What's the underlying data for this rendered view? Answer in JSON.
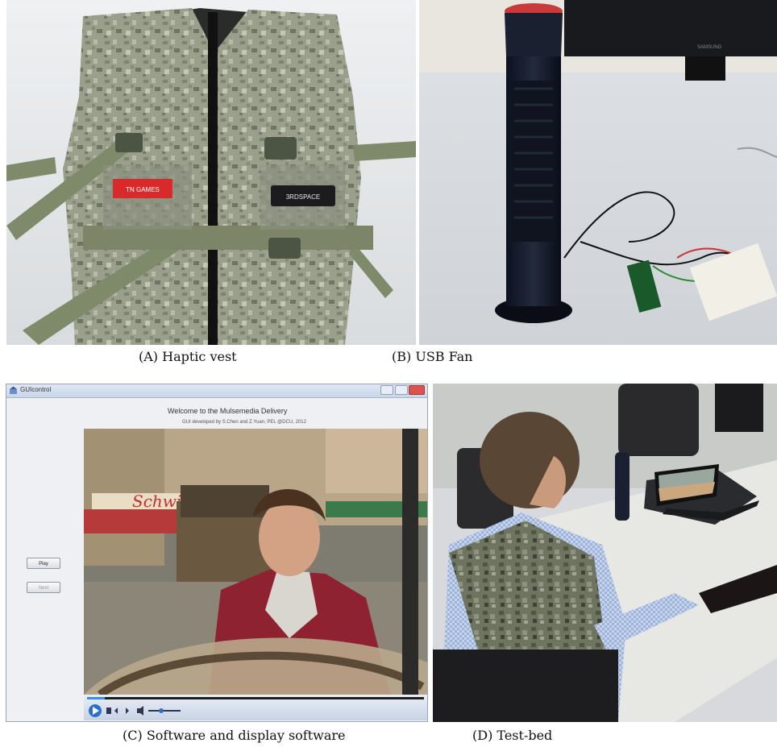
{
  "captions": {
    "a": "(A) Haptic vest",
    "b": "(B) USB Fan",
    "c": "(C)  Software and display software",
    "d": "(D) Test-bed"
  },
  "vest": {
    "badge_left": "TN GAMES",
    "badge_right": "3RDSPACE"
  },
  "monitor_brand": "SAMSUNG",
  "gui": {
    "window_title": "GUIcontrol",
    "heading": "Welcome to the Mulsemedia Delivery",
    "subheading": "GUI developed by S.Chen and Z.Yuan, PEL @DCU, 2012",
    "play_label": "Play",
    "next_label": "Next",
    "shop_sign": "Schwinn"
  },
  "colors": {
    "vest_camo": "#8f9582",
    "strap": "#7f8a6a",
    "fan_body": "#151b2c",
    "desk": "#e6e6e0",
    "gui_bg": "#eef0f3"
  }
}
